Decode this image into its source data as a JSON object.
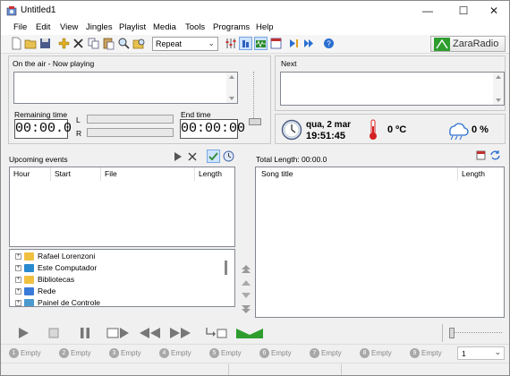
{
  "window": {
    "title": "Untitled1",
    "minimize": "—",
    "maximize": "☐",
    "close": "✕"
  },
  "menu": [
    "File",
    "Edit",
    "View",
    "Jingles",
    "Playlist",
    "Media",
    "Tools",
    "Programs",
    "Help"
  ],
  "toolbar": {
    "mode_select": "Repeat",
    "brand": "ZaraRadio"
  },
  "on_air": {
    "label": "On the air - Now playing",
    "remaining_label": "Remaining time",
    "remaining_value": "00:00.0",
    "end_label": "End time",
    "end_value": "00:00:00",
    "level_left": "L",
    "level_right": "R"
  },
  "next": {
    "label": "Next"
  },
  "status": {
    "date": "qua, 2 mar",
    "time": "19:51:45",
    "temperature": "0 ºC",
    "humidity": "0 %"
  },
  "events": {
    "label": "Upcoming events",
    "columns": [
      "Hour",
      "Start",
      "File",
      "Length"
    ]
  },
  "playlist": {
    "total_length": "Total Length: 00:00.0",
    "columns": [
      "Song title",
      "Length"
    ]
  },
  "tree": [
    "Rafael Lorenzoni",
    "Este Computador",
    "Bibliotecas",
    "Rede",
    "Painel de Controle"
  ],
  "jingles": [
    {
      "num": "1",
      "label": "Empty"
    },
    {
      "num": "2",
      "label": "Empty"
    },
    {
      "num": "3",
      "label": "Empty"
    },
    {
      "num": "4",
      "label": "Empty"
    },
    {
      "num": "5",
      "label": "Empty"
    },
    {
      "num": "6",
      "label": "Empty"
    },
    {
      "num": "7",
      "label": "Empty"
    },
    {
      "num": "8",
      "label": "Empty"
    },
    {
      "num": "9",
      "label": "Empty"
    }
  ],
  "jingle_page": "1",
  "colors": {
    "accent_green": "#2e9d2e",
    "thermo_red": "#d42020",
    "blue_icon": "#2a6fd0"
  }
}
